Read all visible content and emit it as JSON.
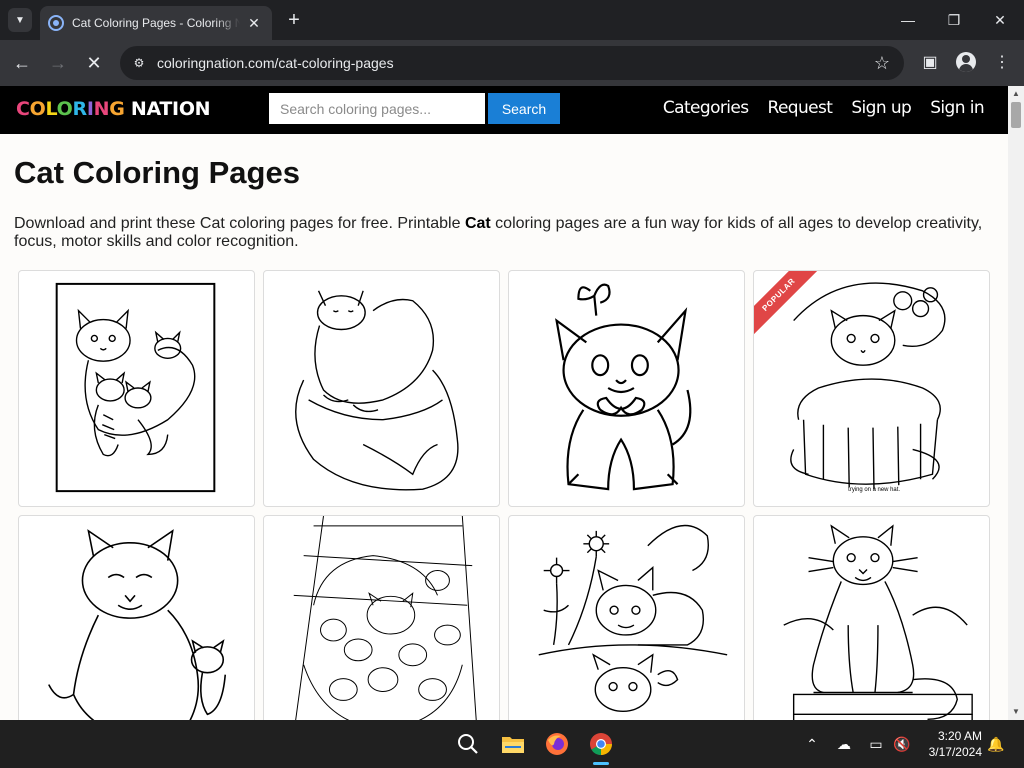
{
  "browser": {
    "tab_title": "Cat Coloring Pages - Coloring Nation",
    "url": "coloringnation.com/cat-coloring-pages",
    "icons": {
      "tab_search": "chevron-down-icon",
      "favicon": "coloring-nation-favicon",
      "tab_close": "close-icon",
      "new_tab": "plus-icon",
      "back": "arrow-left-icon",
      "forward": "arrow-right-icon",
      "loading": "stop-loading-icon",
      "site_info": "tune-icon",
      "bookmark": "star-icon",
      "side_panel": "side-panel-icon",
      "profile": "profile-icon",
      "menu": "kebab-menu-icon"
    }
  },
  "site": {
    "logo_letters": [
      "C",
      "O",
      "L",
      "O",
      "R",
      "I",
      "N",
      "G"
    ],
    "logo_rest": " NATION",
    "search_placeholder": "Search coloring pages...",
    "search_button": "Search",
    "nav": [
      "Categories",
      "Request",
      "Sign up",
      "Sign in"
    ],
    "accent_color": "#1a7fd6"
  },
  "page": {
    "title": "Cat Coloring Pages",
    "intro_before": "Download and print these Cat coloring pages for free. Printable ",
    "intro_bold": "Cat",
    "intro_after": " coloring pages are a fun way for kids of all ages to develop creativity, focus, motor skills and color recognition.",
    "cards": [
      {
        "subject": "cat-family-with-kittens",
        "badge": null
      },
      {
        "subject": "fluffy-cat-on-cushion",
        "badge": null
      },
      {
        "subject": "kitten-with-butterfly-and-bow",
        "badge": null
      },
      {
        "subject": "kitten-in-hat-box",
        "badge": "POPULAR",
        "caption": "trying on a new hat."
      },
      {
        "subject": "mother-cat-and-kitten",
        "badge": null
      },
      {
        "subject": "cat-with-kittens-nursing",
        "badge": null
      },
      {
        "subject": "kitten-with-flowers-and-reflection",
        "badge": null
      },
      {
        "subject": "cat-sitting-on-fence",
        "badge": null
      }
    ]
  },
  "taskbar": {
    "apps": [
      "search-icon",
      "file-explorer-icon",
      "firefox-icon",
      "chrome-icon"
    ],
    "tray": [
      "chevron-up-icon",
      "onedrive-icon",
      "display-icon",
      "volume-muted-icon",
      "notification-bell-icon"
    ],
    "time": "3:20 AM",
    "date": "3/17/2024"
  }
}
